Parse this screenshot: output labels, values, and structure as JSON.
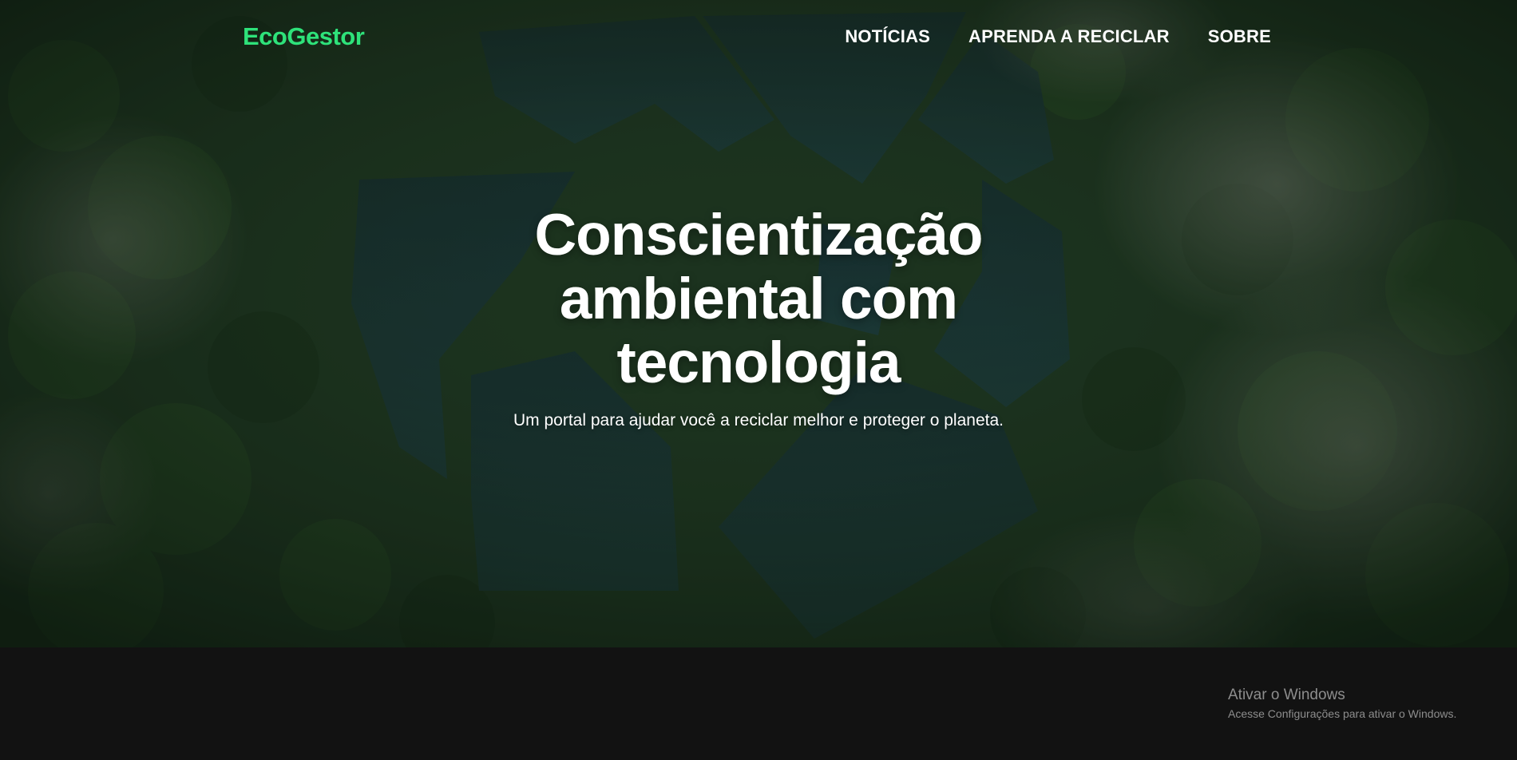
{
  "nav": {
    "logo": "EcoGestor",
    "links": [
      "NOTÍCIAS",
      "APRENDA A RECICLAR",
      "SOBRE"
    ]
  },
  "hero": {
    "title_lines": [
      "Conscientização",
      "ambiental com",
      "tecnologia"
    ],
    "subtitle": "Um portal para ajudar você a reciclar melhor e proteger o planeta."
  },
  "watermark": {
    "title": "Ativar o Windows",
    "subtitle": "Acesse Configurações para ativar o Windows."
  },
  "colors": {
    "brand": "#2ee27a",
    "footer_bg": "#121212",
    "forest": "#1f3a24",
    "water": "#1e4040"
  },
  "icons": [
    "recycle-symbol-lakes"
  ]
}
